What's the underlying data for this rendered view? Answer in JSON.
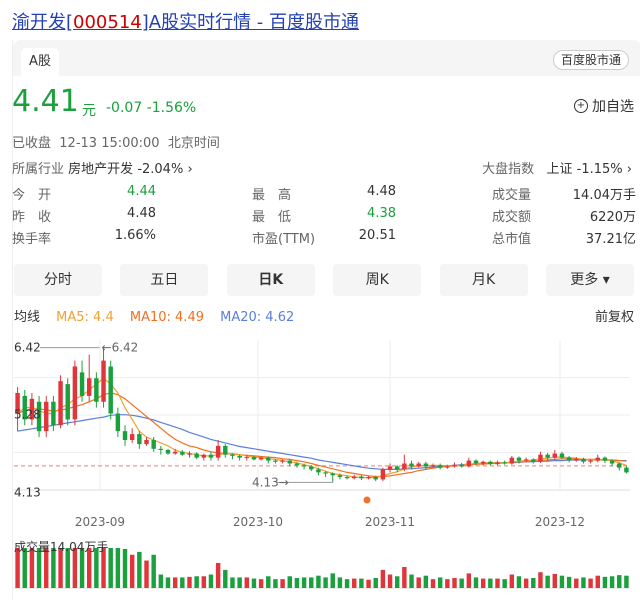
{
  "page": {
    "title_prefix": "渝开发[",
    "title_code": "000514",
    "title_suffix": "]A股实时行情 - 百度股市通"
  },
  "tab": {
    "label": "A股"
  },
  "brand_badge": "百度股市通",
  "quote": {
    "price": "4.41",
    "unit": "元",
    "change": "-0.07",
    "change_pct": "-1.56%",
    "status": "已收盘",
    "time": "12-13 15:00:00",
    "timezone": "北京时间"
  },
  "watch_label": "加自选",
  "industry": {
    "label": "所属行业",
    "name": "房地产开发",
    "change": "-2.04%"
  },
  "market_index": {
    "label": "大盘指数",
    "name": "上证",
    "change": "-1.15%"
  },
  "stats": [
    [
      {
        "label": "今　开",
        "value": "4.44",
        "green": true
      },
      {
        "label": "最　高",
        "value": "4.48",
        "green": false
      },
      {
        "label": "成交量",
        "value": "14.04万手",
        "green": false
      }
    ],
    [
      {
        "label": "昨　收",
        "value": "4.48",
        "green": false
      },
      {
        "label": "最　低",
        "value": "4.38",
        "green": true
      },
      {
        "label": "成交额",
        "value": "6220万",
        "green": false
      }
    ],
    [
      {
        "label": "换手率",
        "value": "1.66%",
        "green": false
      },
      {
        "label": "市盈(TTM)",
        "value": "20.51",
        "green": false
      },
      {
        "label": "总市值",
        "value": "37.21亿",
        "green": false
      }
    ]
  ],
  "periods": [
    "分时",
    "五日",
    "日K",
    "周K",
    "月K",
    "更多"
  ],
  "active_period": "日K",
  "ma": {
    "label": "均线",
    "ma5": "MA5: 4.4",
    "ma10": "MA10: 4.49",
    "ma20": "MA20: 4.62",
    "restore": "前复权"
  },
  "colors": {
    "up": "#e0363b",
    "down": "#1aa03c",
    "ma5": "#f0a030",
    "ma10": "#f07020",
    "ma20": "#5b7fe0",
    "link": "#2440b3"
  },
  "chart_data": {
    "type": "candlestick",
    "x_ticks": [
      "2023-09",
      "2023-10",
      "2023-11",
      "2023-12"
    ],
    "y_labels": [
      "6.42",
      "5.28",
      "4.13"
    ],
    "annotations": {
      "max": "6.42",
      "min": "4.13"
    },
    "candles": [
      [
        5.3,
        5.65,
        5.0,
        5.75
      ],
      [
        5.6,
        5.2,
        5.1,
        5.7
      ],
      [
        5.2,
        5.55,
        5.1,
        5.65
      ],
      [
        5.5,
        5.0,
        4.9,
        5.6
      ],
      [
        5.0,
        5.5,
        4.9,
        5.6
      ],
      [
        5.5,
        5.1,
        5.0,
        5.6
      ],
      [
        5.1,
        5.85,
        5.05,
        5.95
      ],
      [
        5.8,
        5.2,
        5.1,
        5.9
      ],
      [
        5.2,
        6.1,
        5.1,
        6.2
      ],
      [
        6.0,
        5.6,
        5.5,
        6.2
      ],
      [
        5.6,
        5.9,
        5.5,
        6.3
      ],
      [
        5.9,
        5.5,
        5.4,
        6.0
      ],
      [
        5.5,
        6.2,
        5.4,
        6.42
      ],
      [
        6.1,
        5.3,
        5.2,
        6.2
      ],
      [
        5.3,
        5.0,
        4.9,
        5.4
      ],
      [
        5.0,
        4.85,
        4.75,
        5.1
      ],
      [
        4.85,
        4.95,
        4.8,
        5.05
      ],
      [
        4.95,
        4.78,
        4.7,
        5.0
      ],
      [
        4.78,
        4.85,
        4.75,
        4.9
      ],
      [
        4.85,
        4.7,
        4.65,
        4.9
      ],
      [
        4.7,
        4.68,
        4.6,
        4.75
      ],
      [
        4.68,
        4.62,
        4.6,
        4.7
      ],
      [
        4.62,
        4.65,
        4.6,
        4.7
      ],
      [
        4.65,
        4.6,
        4.58,
        4.68
      ],
      [
        4.6,
        4.62,
        4.55,
        4.66
      ],
      [
        4.62,
        4.55,
        4.52,
        4.64
      ],
      [
        4.55,
        4.6,
        4.5,
        4.62
      ],
      [
        4.6,
        4.55,
        4.5,
        4.65
      ],
      [
        4.55,
        4.75,
        4.5,
        4.85
      ],
      [
        4.75,
        4.6,
        4.55,
        4.78
      ],
      [
        4.6,
        4.58,
        4.52,
        4.62
      ],
      [
        4.58,
        4.55,
        4.5,
        4.6
      ],
      [
        4.55,
        4.56,
        4.5,
        4.6
      ],
      [
        4.56,
        4.52,
        4.5,
        4.58
      ],
      [
        4.52,
        4.55,
        4.5,
        4.57
      ],
      [
        4.55,
        4.5,
        4.45,
        4.57
      ],
      [
        4.5,
        4.48,
        4.45,
        4.52
      ],
      [
        4.48,
        4.5,
        4.45,
        4.52
      ],
      [
        4.5,
        4.45,
        4.4,
        4.52
      ],
      [
        4.45,
        4.42,
        4.38,
        4.47
      ],
      [
        4.42,
        4.4,
        4.35,
        4.45
      ],
      [
        4.4,
        4.35,
        4.32,
        4.42
      ],
      [
        4.35,
        4.3,
        4.25,
        4.38
      ],
      [
        4.3,
        4.28,
        4.22,
        4.32
      ],
      [
        4.28,
        4.25,
        4.13,
        4.3
      ],
      [
        4.25,
        4.22,
        4.18,
        4.28
      ],
      [
        4.22,
        4.2,
        4.18,
        4.25
      ],
      [
        4.2,
        4.23,
        4.18,
        4.26
      ],
      [
        4.23,
        4.2,
        4.17,
        4.25
      ],
      [
        4.2,
        4.22,
        4.18,
        4.24
      ],
      [
        4.22,
        4.18,
        4.15,
        4.24
      ],
      [
        4.18,
        4.35,
        4.15,
        4.38
      ],
      [
        4.35,
        4.4,
        4.3,
        4.45
      ],
      [
        4.4,
        4.35,
        4.3,
        4.42
      ],
      [
        4.35,
        4.45,
        4.32,
        4.6
      ],
      [
        4.45,
        4.4,
        4.35,
        4.5
      ],
      [
        4.4,
        4.45,
        4.38,
        4.48
      ],
      [
        4.45,
        4.4,
        4.35,
        4.48
      ],
      [
        4.4,
        4.42,
        4.38,
        4.45
      ],
      [
        4.42,
        4.38,
        4.35,
        4.45
      ],
      [
        4.38,
        4.4,
        4.36,
        4.43
      ],
      [
        4.4,
        4.43,
        4.38,
        4.47
      ],
      [
        4.43,
        4.4,
        4.38,
        4.46
      ],
      [
        4.4,
        4.5,
        4.38,
        4.55
      ],
      [
        4.5,
        4.45,
        4.42,
        4.52
      ],
      [
        4.45,
        4.48,
        4.42,
        4.5
      ],
      [
        4.48,
        4.44,
        4.42,
        4.5
      ],
      [
        4.44,
        4.47,
        4.42,
        4.5
      ],
      [
        4.47,
        4.45,
        4.43,
        4.5
      ],
      [
        4.45,
        4.55,
        4.43,
        4.58
      ],
      [
        4.55,
        4.5,
        4.45,
        4.57
      ],
      [
        4.5,
        4.52,
        4.47,
        4.55
      ],
      [
        4.52,
        4.48,
        4.45,
        4.54
      ],
      [
        4.48,
        4.6,
        4.46,
        4.65
      ],
      [
        4.6,
        4.55,
        4.5,
        4.63
      ],
      [
        4.55,
        4.62,
        4.52,
        4.68
      ],
      [
        4.62,
        4.55,
        4.52,
        4.65
      ],
      [
        4.55,
        4.5,
        4.47,
        4.58
      ],
      [
        4.5,
        4.53,
        4.48,
        4.56
      ],
      [
        4.53,
        4.48,
        4.45,
        4.55
      ],
      [
        4.48,
        4.5,
        4.45,
        4.53
      ],
      [
        4.5,
        4.55,
        4.47,
        4.6
      ],
      [
        4.55,
        4.5,
        4.46,
        4.57
      ],
      [
        4.5,
        4.45,
        4.4,
        4.52
      ],
      [
        4.45,
        4.38,
        4.33,
        4.47
      ],
      [
        4.38,
        4.3,
        4.28,
        4.41
      ]
    ],
    "ma5": [
      5.3,
      5.4,
      5.4,
      5.35,
      5.3,
      5.3,
      5.4,
      5.45,
      5.55,
      5.6,
      5.7,
      5.8,
      5.9,
      5.8,
      5.65,
      5.4,
      5.2,
      5.0,
      4.9,
      4.85,
      4.8,
      4.75,
      4.68,
      4.64,
      4.62,
      4.6,
      4.58,
      4.58,
      4.6,
      4.62,
      4.62,
      4.6,
      4.58,
      4.56,
      4.55,
      4.53,
      4.52,
      4.5,
      4.48,
      4.46,
      4.43,
      4.4,
      4.36,
      4.32,
      4.28,
      4.26,
      4.24,
      4.22,
      4.21,
      4.21,
      4.21,
      4.24,
      4.28,
      4.31,
      4.36,
      4.39,
      4.41,
      4.42,
      4.42,
      4.42,
      4.41,
      4.41,
      4.42,
      4.44,
      4.45,
      4.46,
      4.47,
      4.46,
      4.46,
      4.48,
      4.49,
      4.5,
      4.51,
      4.53,
      4.54,
      4.56,
      4.56,
      4.55,
      4.54,
      4.52,
      4.51,
      4.51,
      4.51,
      4.5,
      4.46,
      4.42
    ],
    "ma10": [
      5.3,
      5.35,
      5.38,
      5.38,
      5.36,
      5.34,
      5.36,
      5.38,
      5.42,
      5.45,
      5.5,
      5.55,
      5.62,
      5.65,
      5.62,
      5.55,
      5.45,
      5.35,
      5.25,
      5.15,
      5.05,
      4.95,
      4.86,
      4.8,
      4.75,
      4.72,
      4.68,
      4.65,
      4.63,
      4.62,
      4.61,
      4.6,
      4.59,
      4.58,
      4.57,
      4.56,
      4.55,
      4.53,
      4.52,
      4.5,
      4.48,
      4.45,
      4.42,
      4.39,
      4.36,
      4.33,
      4.3,
      4.28,
      4.26,
      4.24,
      4.23,
      4.23,
      4.24,
      4.26,
      4.28,
      4.3,
      4.33,
      4.35,
      4.37,
      4.39,
      4.4,
      4.41,
      4.42,
      4.43,
      4.44,
      4.44,
      4.45,
      4.45,
      4.46,
      4.47,
      4.48,
      4.48,
      4.49,
      4.5,
      4.51,
      4.52,
      4.53,
      4.53,
      4.53,
      4.52,
      4.52,
      4.52,
      4.51,
      4.51,
      4.5,
      4.49
    ],
    "ma20": [
      5.0,
      5.02,
      5.04,
      5.06,
      5.08,
      5.1,
      5.12,
      5.14,
      5.16,
      5.18,
      5.2,
      5.22,
      5.24,
      5.27,
      5.28,
      5.28,
      5.27,
      5.25,
      5.22,
      5.19,
      5.15,
      5.11,
      5.07,
      5.03,
      4.98,
      4.94,
      4.9,
      4.86,
      4.83,
      4.8,
      4.77,
      4.74,
      4.72,
      4.7,
      4.68,
      4.66,
      4.64,
      4.62,
      4.6,
      4.58,
      4.56,
      4.54,
      4.51,
      4.49,
      4.47,
      4.45,
      4.43,
      4.41,
      4.39,
      4.37,
      4.36,
      4.35,
      4.35,
      4.35,
      4.36,
      4.36,
      4.37,
      4.38,
      4.39,
      4.4,
      4.41,
      4.42,
      4.43,
      4.44,
      4.44,
      4.45,
      4.45,
      4.46,
      4.46,
      4.47,
      4.47,
      4.48,
      4.48,
      4.49,
      4.49,
      4.5,
      4.5,
      4.51,
      4.51,
      4.51,
      4.51,
      4.51,
      4.51,
      4.51,
      4.5,
      4.5
    ],
    "volume_label": "成交量14.04万手"
  }
}
